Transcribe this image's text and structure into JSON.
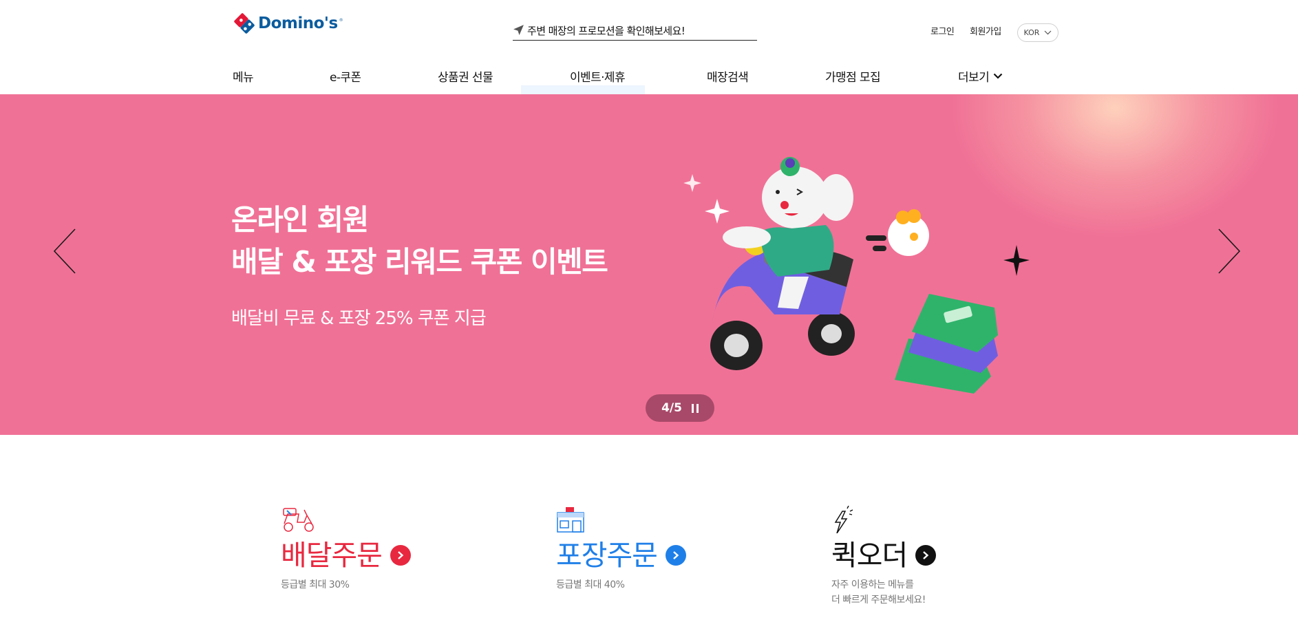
{
  "header": {
    "brand": "Domino's",
    "promo_text": "주변 매장의 프로모션을 확인해보세요!",
    "login": "로그인",
    "signup": "회원가입",
    "language": "KOR"
  },
  "nav": {
    "items": [
      {
        "label": "메뉴"
      },
      {
        "label": "e-쿠폰"
      },
      {
        "label": "상품권 선물"
      },
      {
        "label": "이벤트·제휴"
      },
      {
        "label": "매장검색"
      },
      {
        "label": "가맹점 모집"
      },
      {
        "label": "더보기"
      }
    ]
  },
  "banner": {
    "title_line1": "온라인 회원",
    "title_line2": "배달 & 포장 리워드 쿠폰 이벤트",
    "subtitle": "배달비 무료 & 포장 25% 쿠폰 지급",
    "pager": "4/5",
    "background_color": "#f07196"
  },
  "order": {
    "delivery": {
      "title": "배달주문",
      "desc": "등급별 최대 30%",
      "color": "#e8283f"
    },
    "pickup": {
      "title": "포장주문",
      "desc": "등급별 최대 40%",
      "color": "#1f7fe8"
    },
    "quick": {
      "title": "퀵오더",
      "desc_line1": "자주 이용하는 메뉴를",
      "desc_line2": "더 빠르게 주문해보세요!",
      "color": "#111111"
    }
  },
  "icons": {
    "logo": "dominos-logo-icon",
    "promo": "location-arrow-icon",
    "lang": "chevron-down-icon",
    "prev": "chevron-left-icon",
    "next": "chevron-right-icon",
    "pause": "pause-icon",
    "delivery": "scooter-icon",
    "pickup": "store-icon",
    "quick": "lightning-icon"
  }
}
